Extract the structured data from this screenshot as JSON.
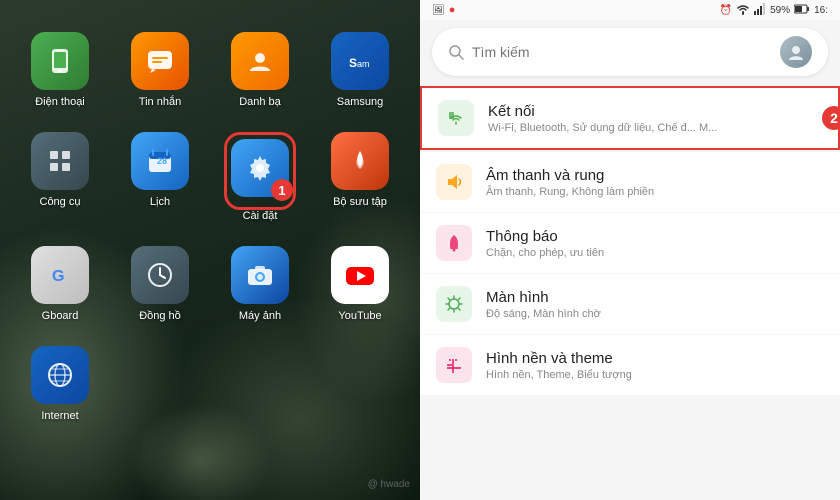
{
  "left": {
    "apps_row1": [
      {
        "id": "dien-thoai",
        "label": "Điện thoại",
        "icon": "phone",
        "color": "icon-phone"
      },
      {
        "id": "tin-nhan",
        "label": "Tin nhắn",
        "icon": "msg",
        "color": "icon-msg"
      },
      {
        "id": "danh-ba",
        "label": "Danh bạ",
        "icon": "contacts",
        "color": "icon-contacts"
      },
      {
        "id": "samsung",
        "label": "Samsung",
        "icon": "samsung",
        "color": "icon-samsung"
      }
    ],
    "apps_row2": [
      {
        "id": "cong-cu",
        "label": "Công cụ",
        "icon": "tools",
        "color": "icon-tools"
      },
      {
        "id": "lich",
        "label": "Lịch",
        "icon": "calendar",
        "color": "icon-calendar"
      },
      {
        "id": "cai-dat",
        "label": "Cài đặt",
        "icon": "settings",
        "color": "icon-settings",
        "highlighted": true,
        "step": "1"
      },
      {
        "id": "bo-suu-tap",
        "label": "Bộ sưu tập",
        "icon": "gallery",
        "color": "icon-gallery"
      }
    ],
    "apps_row3": [
      {
        "id": "gboard",
        "label": "Gboard",
        "icon": "gboard",
        "color": "icon-gboard"
      },
      {
        "id": "dong-ho",
        "label": "Đồng hồ",
        "icon": "clock",
        "color": "icon-clock"
      },
      {
        "id": "may-anh",
        "label": "Máy ảnh",
        "icon": "camera",
        "color": "icon-camera"
      },
      {
        "id": "youtube",
        "label": "YouTube",
        "icon": "youtube",
        "color": "icon-youtube"
      }
    ],
    "apps_row4": [
      {
        "id": "internet",
        "label": "Internet",
        "icon": "internet",
        "color": "icon-internet"
      }
    ],
    "watermark": "@ hwade"
  },
  "right": {
    "statusbar": {
      "left": "◀",
      "battery": "59%",
      "time": "16:"
    },
    "search": {
      "placeholder": "Tìm kiếm"
    },
    "settings_items": [
      {
        "id": "ket-noi",
        "title": "Kết nối",
        "subtitle": "Wi-Fi, Bluetooth, Sử dụng dữ liệu, Chế đ... M...",
        "icon": "wifi",
        "highlighted": true,
        "step2": true
      },
      {
        "id": "am-thanh",
        "title": "Âm thanh và rung",
        "subtitle": "Âm thanh, Rung, Không làm phiền",
        "icon": "sound",
        "highlighted": false
      },
      {
        "id": "thong-bao",
        "title": "Thông báo",
        "subtitle": "Chặn, cho phép, ưu tiên",
        "icon": "notification",
        "highlighted": false
      },
      {
        "id": "man-hinh",
        "title": "Màn hình",
        "subtitle": "Độ sáng, Màn hình chờ",
        "icon": "display",
        "highlighted": false
      },
      {
        "id": "hinh-nen",
        "title": "Hình nền và theme",
        "subtitle": "Hình nền, Theme, Biểu tượng",
        "icon": "wallpaper",
        "highlighted": false
      }
    ]
  }
}
